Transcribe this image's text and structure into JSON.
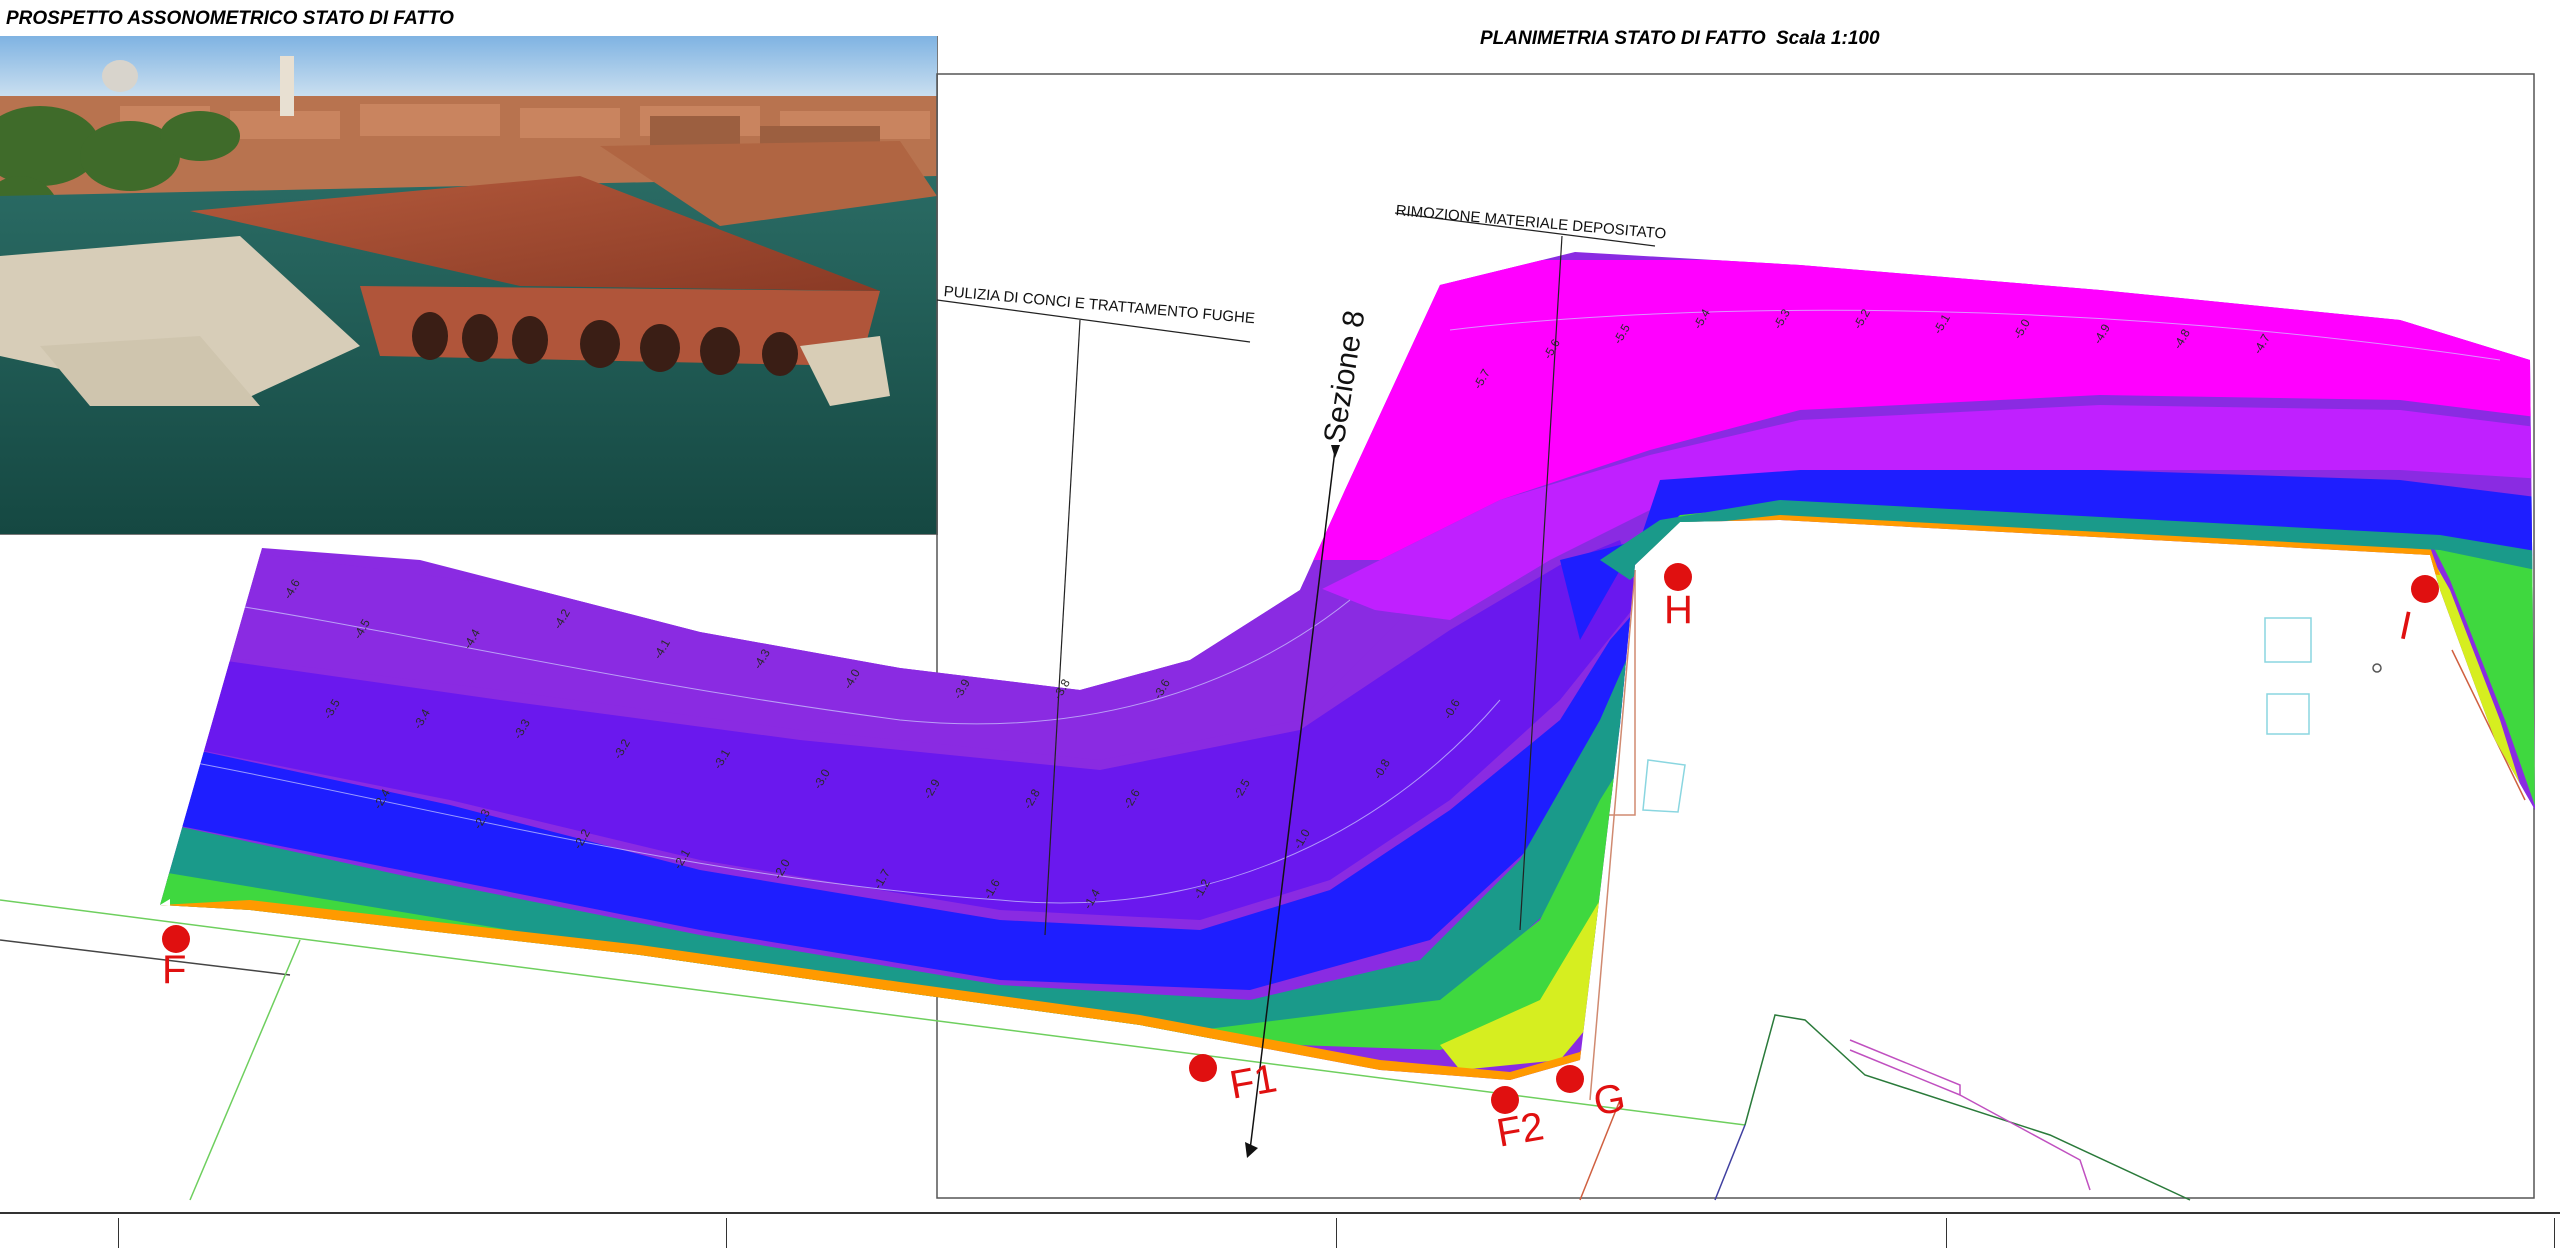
{
  "titles": {
    "photo": "PROSPETTO ASSONOMETRICO STATO DI FATTO",
    "plan": "PLANIMETRIA STATO DI FATTO",
    "scale": "Scala 1:100"
  },
  "annotations": {
    "pulizia": "PULIZIA DI CONCI E TRATTAMENTO FUGHE",
    "rimozione": "RIMOZIONE MATERIALE DEPOSITATO",
    "section": "Sezione 8"
  },
  "markers": [
    {
      "id": "F",
      "label": "F"
    },
    {
      "id": "F1",
      "label": "F1"
    },
    {
      "id": "F2",
      "label": "F2"
    },
    {
      "id": "G",
      "label": "G"
    },
    {
      "id": "H",
      "label": "H"
    },
    {
      "id": "I",
      "label": "I"
    }
  ],
  "depth_scale": {
    "unit": "m",
    "min": -5.8,
    "max": -0.6
  },
  "depth_labels": [
    {
      "v": "-4.6"
    },
    {
      "v": "-4.5"
    },
    {
      "v": "-4.4"
    },
    {
      "v": "-4.2"
    },
    {
      "v": "-4.1"
    },
    {
      "v": "-4.3"
    },
    {
      "v": "-4.0"
    },
    {
      "v": "-3.9"
    },
    {
      "v": "-3.8"
    },
    {
      "v": "-3.6"
    },
    {
      "v": "-3.5"
    },
    {
      "v": "-3.4"
    },
    {
      "v": "-3.3"
    },
    {
      "v": "-3.2"
    },
    {
      "v": "-3.1"
    },
    {
      "v": "-3.0"
    },
    {
      "v": "-2.9"
    },
    {
      "v": "-2.8"
    },
    {
      "v": "-2.6"
    },
    {
      "v": "-2.5"
    },
    {
      "v": "-2.4"
    },
    {
      "v": "-2.3"
    },
    {
      "v": "-2.2"
    },
    {
      "v": "-2.1"
    },
    {
      "v": "-2.0"
    },
    {
      "v": "-1.7"
    },
    {
      "v": "-1.6"
    },
    {
      "v": "-1.4"
    },
    {
      "v": "-1.2"
    },
    {
      "v": "-1.0"
    },
    {
      "v": "-0.8"
    },
    {
      "v": "-0.6"
    },
    {
      "v": "-5.7"
    },
    {
      "v": "-5.6"
    },
    {
      "v": "-5.5"
    },
    {
      "v": "-5.4"
    },
    {
      "v": "-5.3"
    },
    {
      "v": "-5.2"
    },
    {
      "v": "-5.1"
    },
    {
      "v": "-5.0"
    },
    {
      "v": "-4.9"
    },
    {
      "v": "-4.8"
    },
    {
      "v": "-4.7"
    }
  ],
  "colors": {
    "deep": "#ff00ff",
    "mid_deep": "#8a2be2",
    "mid": "#1e1eff",
    "teal": "#1a9a8a",
    "green": "#3fd83f",
    "yellow": "#e8f000",
    "orange": "#ff9a00",
    "marker": "#e01010",
    "water": "#1f5a55",
    "roof": "#a4472f",
    "sky": "#9ec7e8"
  }
}
